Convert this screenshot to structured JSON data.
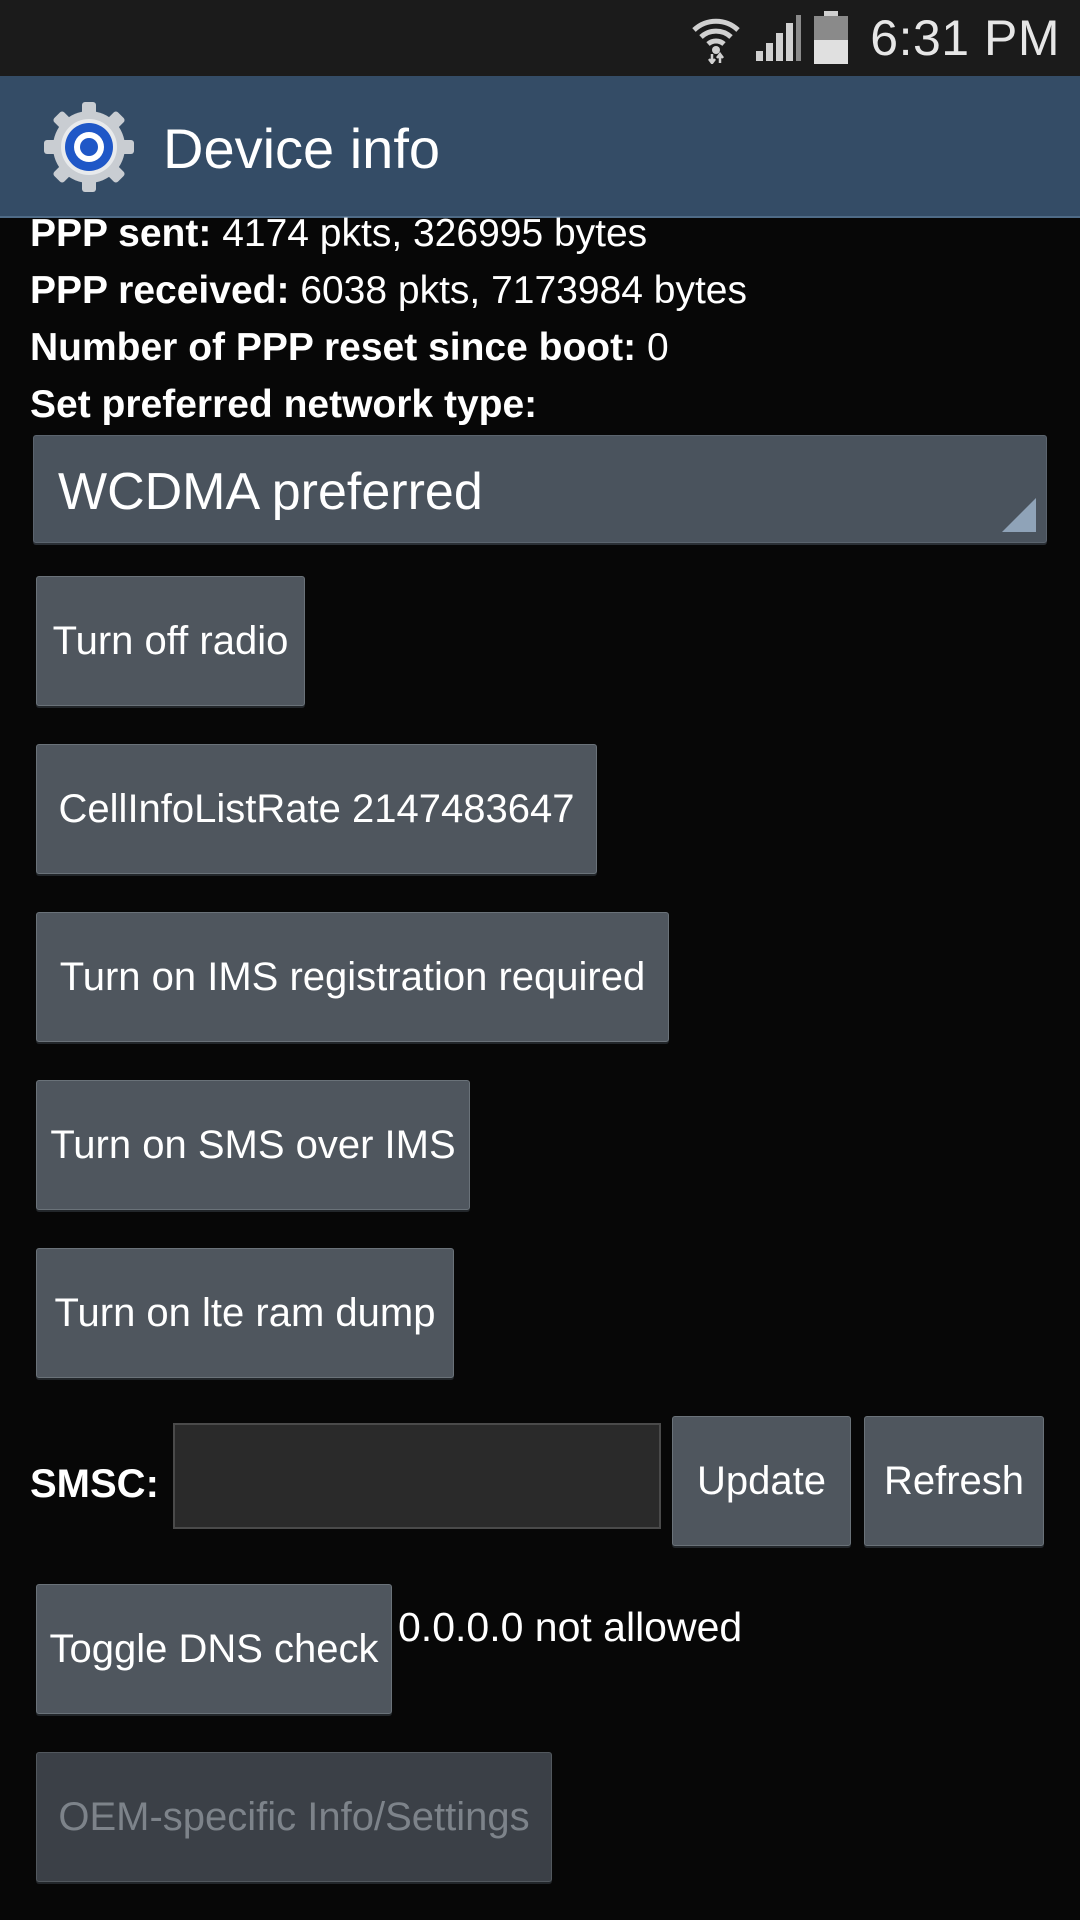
{
  "status_bar": {
    "time": "6:31 PM",
    "icons": [
      "wifi-icon",
      "signal-icon",
      "battery-icon"
    ]
  },
  "action_bar": {
    "title": "Device info",
    "icon": "settings-gear-icon"
  },
  "info": {
    "ppp_sent_label": "PPP sent:",
    "ppp_sent_value": "4174 pkts, 326995 bytes",
    "ppp_received_label": "PPP received:",
    "ppp_received_value": "6038 pkts, 7173984 bytes",
    "ppp_reset_label": "Number of PPP reset since boot:",
    "ppp_reset_value": "0",
    "network_type_label": "Set preferred network type:"
  },
  "network_type": {
    "selected": "WCDMA preferred"
  },
  "buttons": {
    "turn_off_radio": "Turn off radio",
    "cell_info_rate": "CellInfoListRate 2147483647",
    "ims_registration": "Turn on IMS registration required",
    "sms_over_ims": "Turn on SMS over IMS",
    "lte_ram_dump": "Turn on lte ram dump",
    "update": "Update",
    "refresh": "Refresh",
    "toggle_dns": "Toggle DNS check",
    "oem_settings": "OEM-specific Info/Settings"
  },
  "smsc": {
    "label": "SMSC:",
    "value": ""
  },
  "dns_status": "0.0.0.0 not allowed",
  "colors": {
    "background": "#070707",
    "action_bar": "#344c66",
    "button": "#4f565e"
  }
}
